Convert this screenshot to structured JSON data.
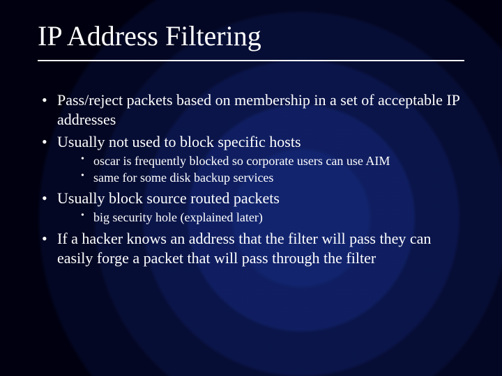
{
  "title": "IP Address Filtering",
  "bullets": {
    "b1": "Pass/reject packets based on membership in a set of acceptable IP addresses",
    "b2": "Usually not used to block specific hosts",
    "b2_sub": {
      "s1": "oscar is frequently blocked so corporate users can use AIM",
      "s2": "same for some disk backup services"
    },
    "b3": "Usually block source routed packets",
    "b3_sub": {
      "s1": "big security hole (explained later)"
    },
    "b4": "If a hacker knows an address that the filter will pass they can easily forge a packet that will pass through the filter"
  }
}
